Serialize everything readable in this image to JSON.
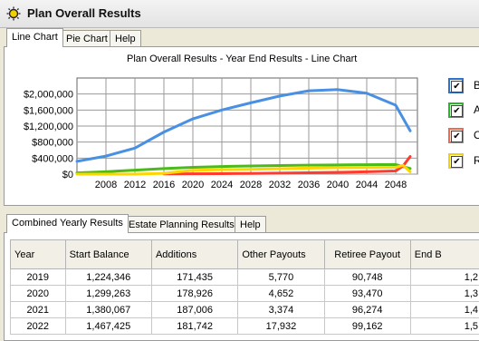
{
  "window": {
    "title": "Plan Overall Results",
    "icon": "sun-icon"
  },
  "top_tabs": [
    "Line Chart",
    "Pie Chart",
    "Help"
  ],
  "active_top_tab": 0,
  "chart_data": {
    "type": "line",
    "title": "Plan Overall Results - Year End Results - Line Chart",
    "xlabel": "",
    "ylabel": "",
    "xlim": [
      2004,
      2051
    ],
    "ylim": [
      0,
      2400000
    ],
    "x_ticks": [
      2008,
      2012,
      2016,
      2020,
      2024,
      2028,
      2032,
      2036,
      2040,
      2044,
      2048
    ],
    "x_tick_labels": [
      "2008",
      "2012",
      "2016",
      "2020",
      "2024",
      "2028",
      "2032",
      "2036",
      "2040",
      "2044",
      "2048"
    ],
    "y_ticks": [
      0,
      400000,
      800000,
      1200000,
      1600000,
      2000000
    ],
    "y_tick_labels": [
      "$0",
      "$400,000",
      "$800,000",
      "$1,200,000",
      "$1,600,000",
      "$2,000,000"
    ],
    "grid": true,
    "legend_position": "right",
    "series": [
      {
        "name": "B",
        "color": "#4a90e2",
        "x": [
          2004,
          2008,
          2012,
          2016,
          2020,
          2024,
          2028,
          2032,
          2036,
          2040,
          2044,
          2048,
          2050
        ],
        "y": [
          320000,
          450000,
          650000,
          1050000,
          1380000,
          1600000,
          1780000,
          1950000,
          2080000,
          2110000,
          2020000,
          1720000,
          1080000
        ]
      },
      {
        "name": "A",
        "color": "#4cbb17",
        "x": [
          2004,
          2008,
          2012,
          2016,
          2020,
          2024,
          2028,
          2032,
          2036,
          2040,
          2044,
          2048,
          2050
        ],
        "y": [
          30000,
          60000,
          100000,
          140000,
          170000,
          190000,
          205000,
          215000,
          225000,
          230000,
          235000,
          240000,
          140000
        ]
      },
      {
        "name": "O",
        "color": "#ff3b30",
        "x": [
          2016,
          2020,
          2024,
          2028,
          2032,
          2036,
          2040,
          2044,
          2048,
          2049,
          2050
        ],
        "y": [
          6000,
          8000,
          12000,
          18000,
          25000,
          35000,
          45000,
          60000,
          80000,
          200000,
          440000
        ]
      },
      {
        "name": "R",
        "color": "#ffd500",
        "x": [
          2004,
          2008,
          2012,
          2016,
          2020,
          2024,
          2028,
          2032,
          2036,
          2040,
          2044,
          2048,
          2049,
          2050
        ],
        "y": [
          0,
          0,
          0,
          20000,
          95000,
          110000,
          120000,
          135000,
          150000,
          160000,
          165000,
          170000,
          220000,
          60000
        ]
      }
    ]
  },
  "legend": [
    {
      "label": "B",
      "color": "#2f72c9",
      "checked": true
    },
    {
      "label": "A",
      "color": "#1fbf1f",
      "checked": true
    },
    {
      "label": "O",
      "color": "#ef6b4f",
      "checked": true
    },
    {
      "label": "R",
      "color": "#f2d20c",
      "checked": true
    }
  ],
  "bottom_tabs": [
    "Combined Yearly Results",
    "Estate Planning Results",
    "Help"
  ],
  "active_bottom_tab": 0,
  "table": {
    "columns": [
      "Year",
      "Start Balance",
      "Additions",
      "Other Payouts",
      "Retiree Payout",
      "End B"
    ],
    "rows": [
      [
        "2019",
        "1,224,346",
        "171,435",
        "5,770",
        "90,748",
        "1,2"
      ],
      [
        "2020",
        "1,299,263",
        "178,926",
        "4,652",
        "93,470",
        "1,3"
      ],
      [
        "2021",
        "1,380,067",
        "187,006",
        "3,374",
        "96,274",
        "1,4"
      ],
      [
        "2022",
        "1,467,425",
        "181,742",
        "17,932",
        "99,162",
        "1,5"
      ]
    ]
  }
}
